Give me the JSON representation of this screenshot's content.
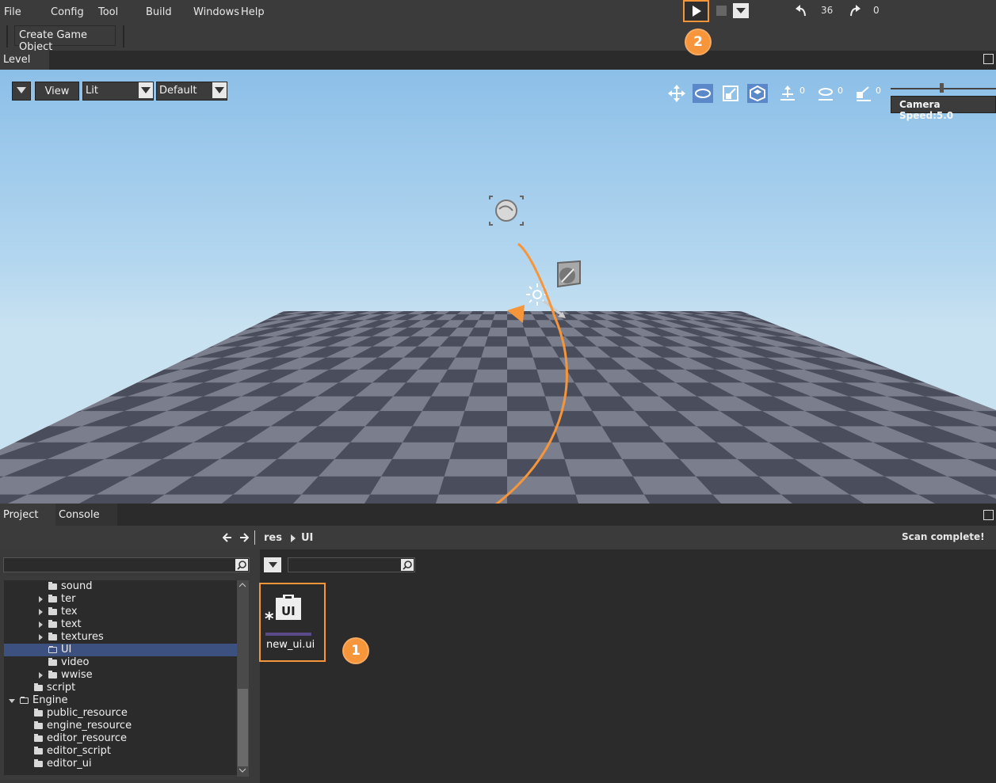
{
  "menu": [
    "File",
    "Config",
    "Tool",
    "Build",
    "Windows",
    "Help"
  ],
  "toolbar": {
    "create_game_object": "Create Game Object",
    "undo_count": "36",
    "redo_count": "0"
  },
  "level": {
    "tab": "Level"
  },
  "viewport": {
    "view_label": "View",
    "shading": "Lit",
    "preset": "Default",
    "tool_counts": [
      "0",
      "0",
      "0"
    ],
    "camera_speed": "Camera Speed:5.0"
  },
  "bottom": {
    "tabs": [
      "Project",
      "Console"
    ],
    "breadcrumb": [
      "res",
      "UI"
    ],
    "status": "Scan complete!",
    "tree": [
      {
        "label": "sound",
        "indent": 3,
        "arrow": "none",
        "open": false
      },
      {
        "label": "ter",
        "indent": 3,
        "arrow": "right",
        "open": false
      },
      {
        "label": "tex",
        "indent": 3,
        "arrow": "right",
        "open": false
      },
      {
        "label": "text",
        "indent": 3,
        "arrow": "right",
        "open": false
      },
      {
        "label": "textures",
        "indent": 3,
        "arrow": "right",
        "open": false
      },
      {
        "label": "UI",
        "indent": 3,
        "arrow": "none",
        "open": true,
        "selected": true
      },
      {
        "label": "video",
        "indent": 3,
        "arrow": "none",
        "open": false
      },
      {
        "label": "wwise",
        "indent": 3,
        "arrow": "right",
        "open": false
      },
      {
        "label": "script",
        "indent": 2,
        "arrow": "none",
        "open": false
      },
      {
        "label": "Engine",
        "indent": 1,
        "arrow": "down",
        "open": true
      },
      {
        "label": "public_resource",
        "indent": 2,
        "arrow": "none",
        "open": false
      },
      {
        "label": "engine_resource",
        "indent": 2,
        "arrow": "none",
        "open": false
      },
      {
        "label": "editor_resource",
        "indent": 2,
        "arrow": "none",
        "open": false
      },
      {
        "label": "editor_script",
        "indent": 2,
        "arrow": "none",
        "open": false
      },
      {
        "label": "editor_ui",
        "indent": 2,
        "arrow": "none",
        "open": false
      }
    ],
    "file": {
      "name": "new_ui.ui",
      "icon_text": "UI"
    }
  },
  "annotations": [
    "1",
    "2"
  ],
  "colors": {
    "accent": "#f7953a",
    "selection": "#3d5181"
  }
}
